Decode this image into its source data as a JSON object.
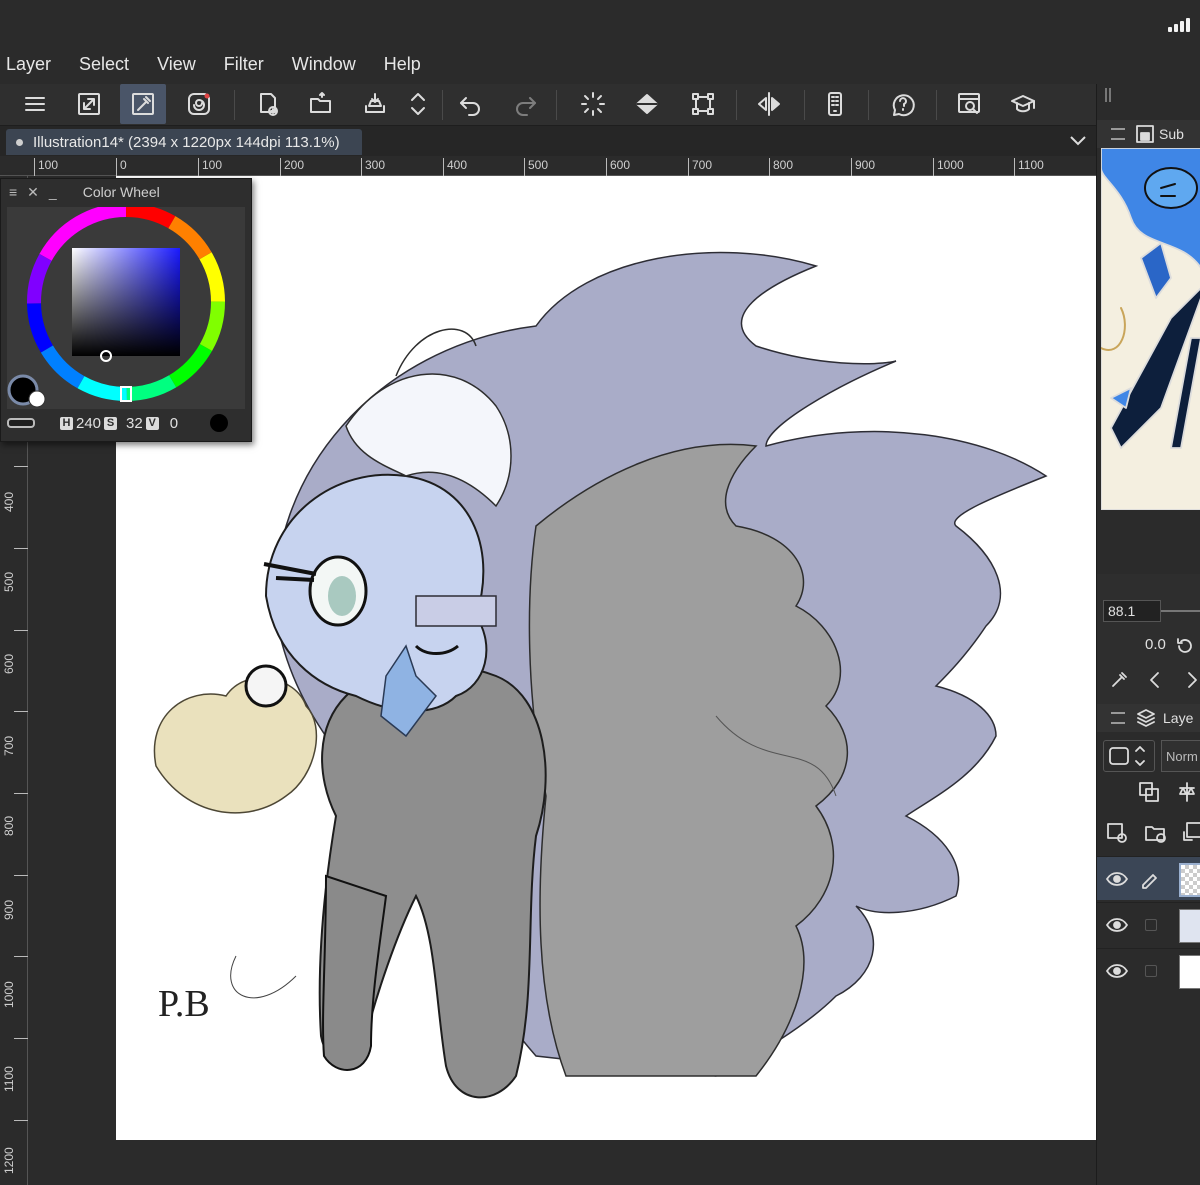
{
  "menubar": {
    "items": [
      "Layer",
      "Select",
      "View",
      "Filter",
      "Window",
      "Help"
    ]
  },
  "toolbar": {
    "buttons": [
      "menu-icon",
      "fit-screen-icon",
      "eyedropper-settings-icon",
      "clip-studio-icon",
      "new-canvas-icon",
      "open-icon",
      "save-icon",
      "up-down-arrows-icon",
      "undo-icon",
      "redo-icon",
      "loading-spinner-icon",
      "fill-icon",
      "transform-icon",
      "flip-horizontal-icon",
      "smartphone-companion-icon",
      "help-icon",
      "search-tool-icon",
      "learn-icon"
    ]
  },
  "document": {
    "tab_title": "Illustration14* (2394 x 1220px 144dpi 113.1%)"
  },
  "ruler": {
    "top_labels": [
      "100",
      "0",
      "100",
      "200",
      "300",
      "400",
      "500",
      "600",
      "700",
      "800",
      "900",
      "1000",
      "1100"
    ],
    "left_labels": [
      "400",
      "500",
      "600",
      "700",
      "800",
      "900",
      "1000",
      "1100",
      "1200"
    ]
  },
  "color_wheel": {
    "title": "Color Wheel",
    "h_label": "H",
    "h_value": "240",
    "s_label": "S",
    "s_value": "32",
    "v_label": "V",
    "v_value": "0",
    "main_color": "#000000",
    "hue_color": "#1a1aff"
  },
  "right_panel": {
    "sub_view_label": "Sub",
    "navigator_zoom": "88.1",
    "navigator_rotation": "0.0",
    "layer_panel_label": "Laye",
    "blend_mode": "Norm"
  },
  "artwork": {
    "signature": "P.B"
  },
  "colors": {
    "background": "#2b2b2b",
    "active_tool": "#4a5568",
    "selected_layer": "#3b4656"
  }
}
